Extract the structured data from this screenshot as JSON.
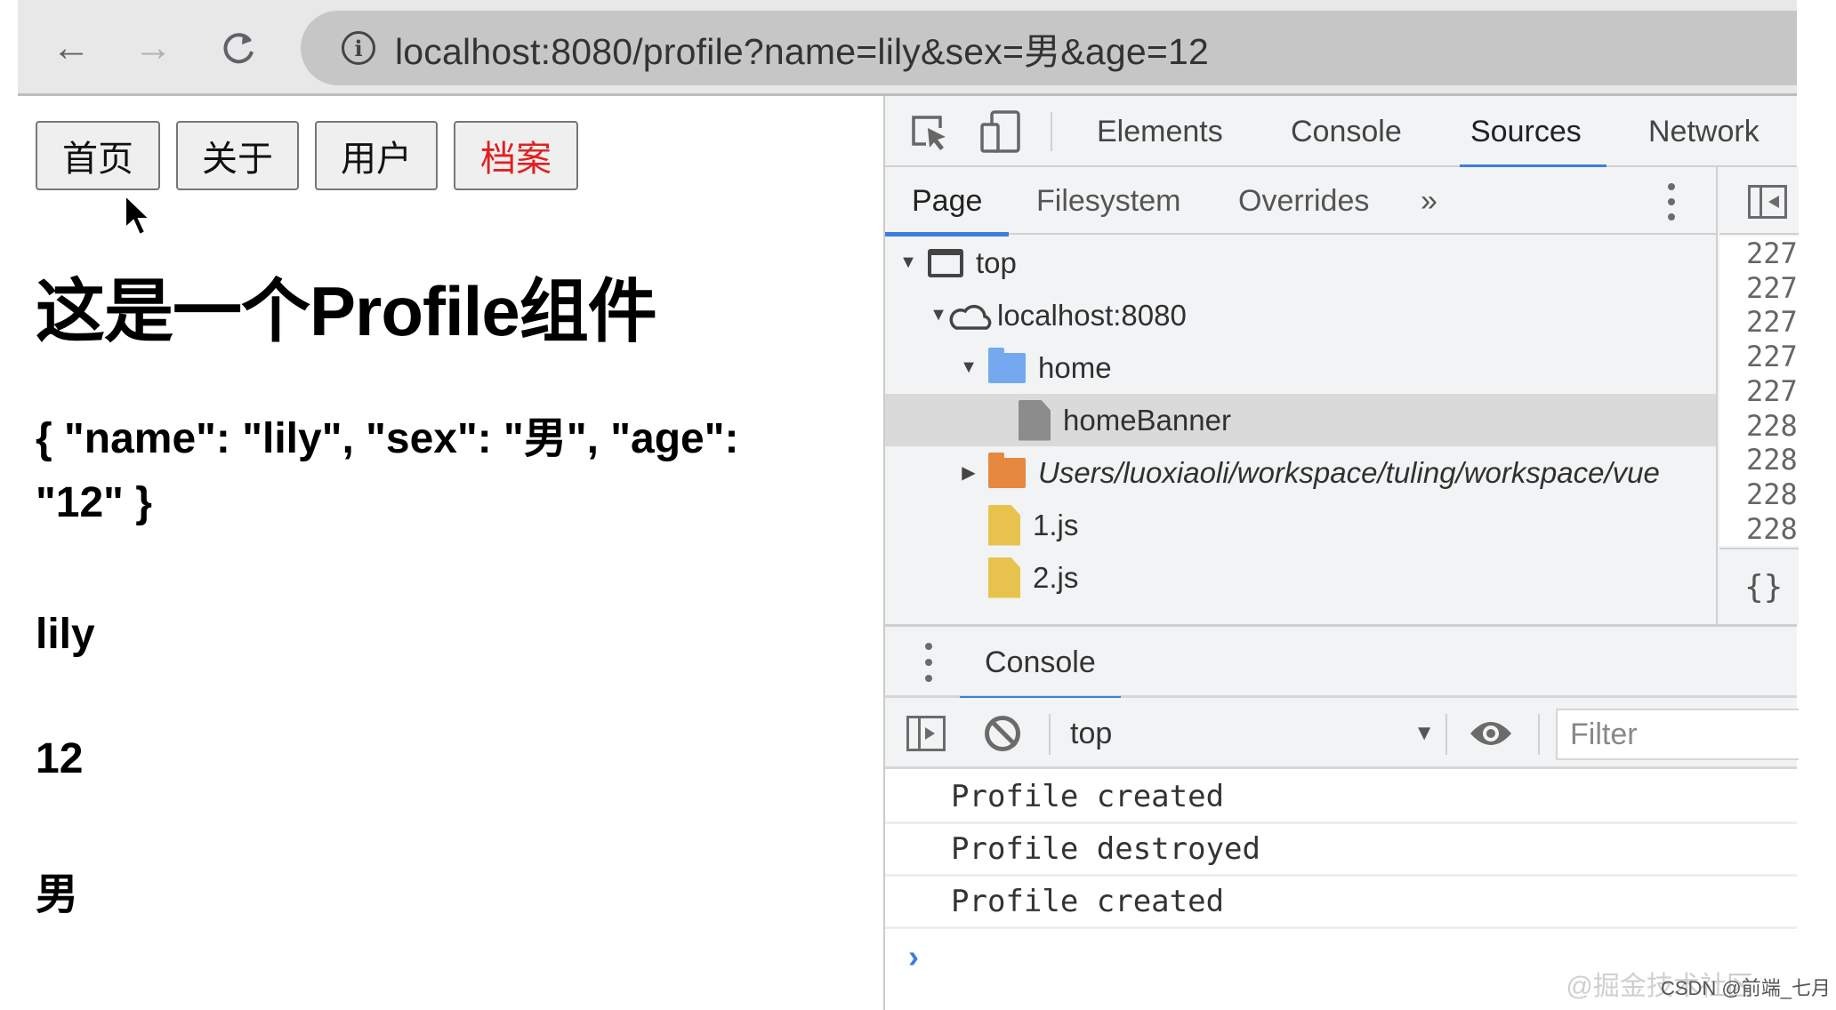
{
  "browser": {
    "back_icon": "arrow-left-icon",
    "forward_icon": "arrow-right-icon",
    "reload_icon": "reload-icon",
    "site_info_icon": "info-icon",
    "url": "localhost:8080/profile?name=lily&sex=男&age=12"
  },
  "page": {
    "nav_links": [
      {
        "label": "首页",
        "active": false
      },
      {
        "label": "关于",
        "active": false
      },
      {
        "label": "用户",
        "active": false
      },
      {
        "label": "档案",
        "active": true
      }
    ],
    "active_link_color": "#e02020",
    "title": "这是一个Profile组件",
    "query_json": "{ \"name\": \"lily\", \"sex\": \"男\", \"age\": \"12\" }",
    "name_value": "lily",
    "age_value": "12",
    "sex_value": "男"
  },
  "devtools": {
    "main_tabs": [
      {
        "label": "Elements",
        "active": false
      },
      {
        "label": "Console",
        "active": false
      },
      {
        "label": "Sources",
        "active": true
      },
      {
        "label": "Network",
        "active": false
      }
    ],
    "accent_color": "#3f7ce0",
    "navigator_tabs": [
      {
        "label": "Page",
        "active": true
      },
      {
        "label": "Filesystem",
        "active": false
      },
      {
        "label": "Overrides",
        "active": false
      }
    ],
    "more_tabs_label": "»",
    "file_tree": [
      {
        "label": "top",
        "type": "frame",
        "expanded": true,
        "depth": 0
      },
      {
        "label": "localhost:8080",
        "type": "origin",
        "expanded": true,
        "depth": 1
      },
      {
        "label": "home",
        "type": "folder",
        "expanded": true,
        "depth": 2
      },
      {
        "label": "homeBanner",
        "type": "file",
        "selected": true,
        "depth": 3
      },
      {
        "label": "Users/luoxiaoli/workspace/tuling/workspace/vue",
        "type": "folder-fs",
        "expanded": false,
        "depth": 2
      },
      {
        "label": "1.js",
        "type": "js-file",
        "depth": 2
      },
      {
        "label": "2.js",
        "type": "js-file",
        "depth": 2
      }
    ],
    "line_numbers": [
      "227",
      "227",
      "227",
      "227",
      "227",
      "228",
      "228",
      "228",
      "228"
    ],
    "pretty_print_label": "{}",
    "drawer": {
      "tab_label": "Console",
      "context": "top",
      "filter_placeholder": "Filter",
      "messages": [
        "Profile created",
        "Profile destroyed",
        "Profile created"
      ],
      "prompt": "›"
    }
  },
  "watermark": {
    "faint": "@掘金技术社区",
    "text": "CSDN @前端_七月"
  }
}
